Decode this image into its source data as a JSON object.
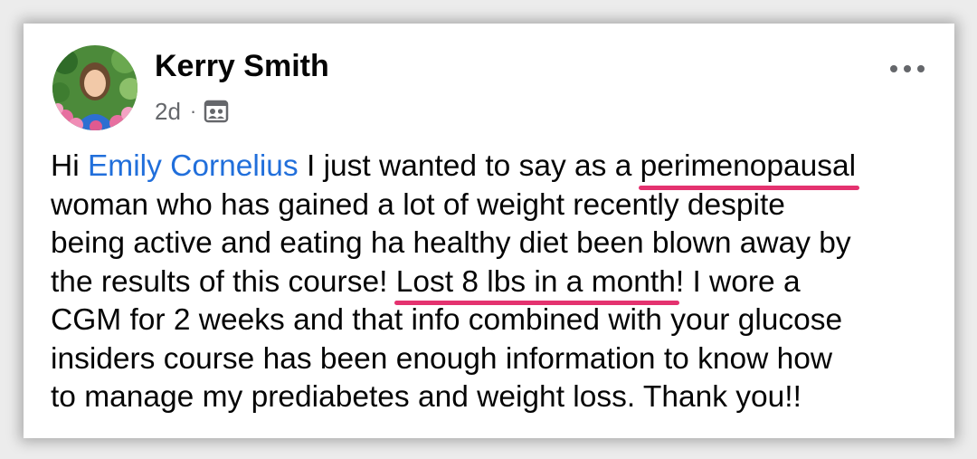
{
  "post": {
    "author": "Kerry Smith",
    "age": "2d",
    "separator": "·",
    "audience_icon": "friends-audience-icon",
    "more_label": "•••",
    "mention": "Emily Cornelius",
    "lines": {
      "l1_a": "Hi ",
      "l1_b": " I just wanted to say as a ",
      "l1_highlight": "perimenopausal",
      "l2": "woman who has gained a lot of weight recently despite",
      "l3": "being active and eating ha healthy diet been blown away by",
      "l4_a": "the results of this course! ",
      "l4_highlight": "Lost 8 lbs in a month",
      "l4_b": "! I wore a",
      "l5": "CGM for 2 weeks and that info combined with your glucose",
      "l6": "insiders course has been enough information to know how",
      "l7": "to manage my prediabetes and weight loss. Thank you!!"
    }
  },
  "colors": {
    "mention": "#216fdb",
    "underline_highlight": "#e4326f",
    "meta_text": "#65676b"
  }
}
